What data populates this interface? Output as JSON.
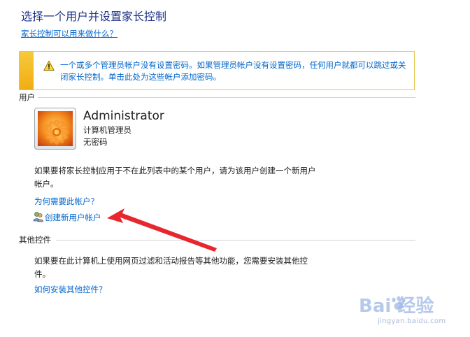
{
  "page": {
    "title": "选择一个用户并设置家长控制",
    "help_link": "家长控制可以用来做什么？"
  },
  "warning": {
    "text": "一个或多个管理员帐户没有设置密码。如果管理员帐户没有设置密码，任何用户就都可以跳过或关闭家长控制。单击此处为这些帐户添加密码。",
    "icon": "warning-icon",
    "strip_color": "#f3b82a"
  },
  "users_section": {
    "label": "用户",
    "user": {
      "name": "Administrator",
      "role": "计算机管理员",
      "password_status": "无密码"
    },
    "description": "如果要将家长控制应用于不在此列表中的某个用户，请为该用户创建一个新用户帐户。",
    "why_link": "为何需要此帐户？",
    "create_link": "创建新用户帐户"
  },
  "other_controls_section": {
    "label": "其他控件",
    "description": "如果要在此计算机上使用网页过滤和活动报告等其他功能，您需要安装其他控件。",
    "install_link": "如何安装其他控件？"
  },
  "watermark": {
    "logo": "Bai 经验",
    "url": "jingyan.baidu.com"
  },
  "colors": {
    "title": "#1e3287",
    "link": "#0066cc",
    "annotation_arrow": "#e8262d"
  }
}
